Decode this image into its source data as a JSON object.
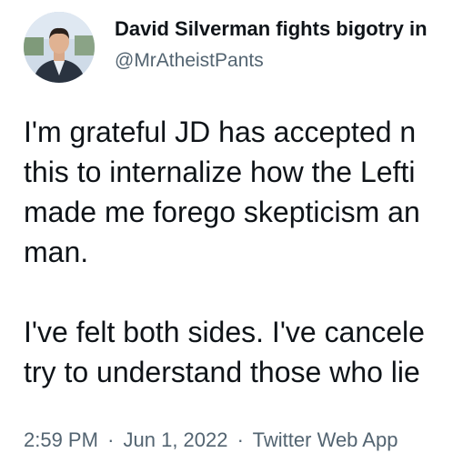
{
  "author": {
    "display_name": "David Silverman fights bigotry in",
    "handle": "@MrAtheistPants"
  },
  "tweet": {
    "paragraph1": [
      "I'm grateful JD has accepted n",
      "this to internalize how the Lefti",
      "made me forego skepticism an",
      "man."
    ],
    "paragraph2": [
      "I've felt both sides. I've cancele",
      "try to understand those who lie"
    ]
  },
  "meta": {
    "time": "2:59 PM",
    "separator": "·",
    "date": "Jun 1, 2022",
    "source": "Twitter Web App"
  },
  "colors": {
    "text": "#0f1419",
    "secondary": "#536471",
    "background": "#ffffff"
  }
}
